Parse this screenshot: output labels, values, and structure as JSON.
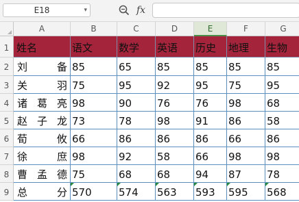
{
  "formula_bar": {
    "name_box": "E18",
    "name_box_arrow": "▾",
    "fx_label": "fx",
    "formula": ""
  },
  "columns": [
    "A",
    "B",
    "C",
    "D",
    "E",
    "F",
    "G"
  ],
  "selected_column": "E",
  "rows": [
    "1",
    "2",
    "3",
    "4",
    "5",
    "6",
    "7",
    "8",
    "9"
  ],
  "table": {
    "header": [
      "姓名",
      "语文",
      "数学",
      "英语",
      "历史",
      "地理",
      "生物"
    ],
    "records": [
      {
        "name": [
          "刘",
          "备"
        ],
        "scores": [
          "85",
          "65",
          "85",
          "85",
          "85",
          "85"
        ]
      },
      {
        "name": [
          "关",
          "羽"
        ],
        "scores": [
          "75",
          "95",
          "92",
          "95",
          "75",
          "95"
        ]
      },
      {
        "name": [
          "诸",
          "葛",
          "亮"
        ],
        "scores": [
          "98",
          "90",
          "76",
          "76",
          "98",
          "68"
        ]
      },
      {
        "name": [
          "赵",
          "子",
          "龙"
        ],
        "scores": [
          "73",
          "78",
          "98",
          "91",
          "86",
          "58"
        ]
      },
      {
        "name": [
          "荀",
          "攸"
        ],
        "scores": [
          "66",
          "86",
          "86",
          "86",
          "66",
          "86"
        ]
      },
      {
        "name": [
          "徐",
          "庶"
        ],
        "scores": [
          "98",
          "92",
          "58",
          "66",
          "98",
          "98"
        ]
      },
      {
        "name": [
          "曹",
          "孟",
          "德"
        ],
        "scores": [
          "75",
          "68",
          "68",
          "94",
          "87",
          "78"
        ]
      },
      {
        "name": [
          "总",
          "分"
        ],
        "scores": [
          "570",
          "574",
          "563",
          "593",
          "595",
          "568"
        ]
      }
    ]
  },
  "colors": {
    "header_fill": "#a3243b",
    "cell_border": "#5a8fc0",
    "selected_header": "#dfe7d7",
    "formula_marker": "#2a8a3a"
  }
}
